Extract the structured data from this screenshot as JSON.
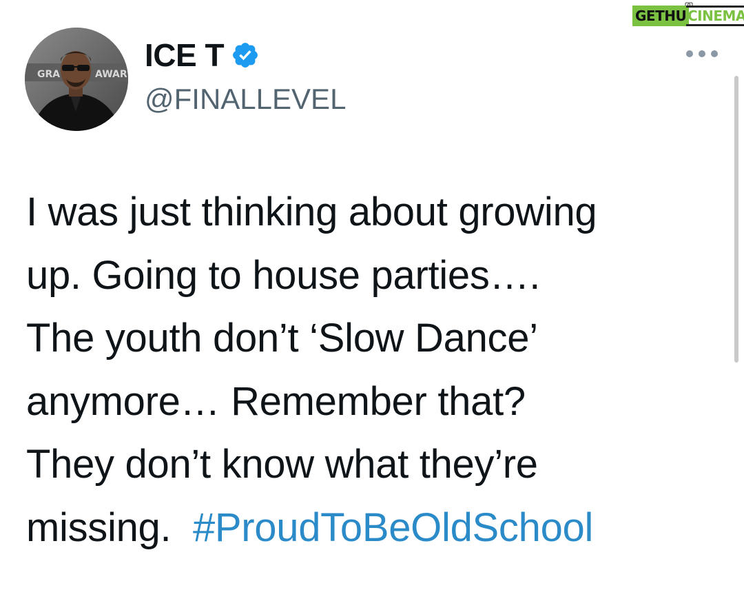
{
  "watermark": {
    "part1": "GETHU",
    "part2": "CINEMA",
    "accent_color": "#7cc242"
  },
  "tweet": {
    "author": {
      "display_name": "ICE T",
      "handle": "@FINALLEVEL",
      "verified": true,
      "avatar_backdrop_text": [
        "GRA",
        "AWAR"
      ]
    },
    "text_lines": [
      "I was just thinking about growing",
      "up. Going to house parties….",
      "The youth don’t ‘Slow Dance’",
      "anymore…  Remember that?",
      "They don’t know what they’re",
      "missing.  "
    ],
    "hashtag": "#ProudToBeOldSchool",
    "colors": {
      "text": "#0f1419",
      "handle": "#536471",
      "hashtag": "#2b8ac8",
      "verified": "#1d9bf0"
    },
    "more_icon": "more-horizontal-icon"
  }
}
